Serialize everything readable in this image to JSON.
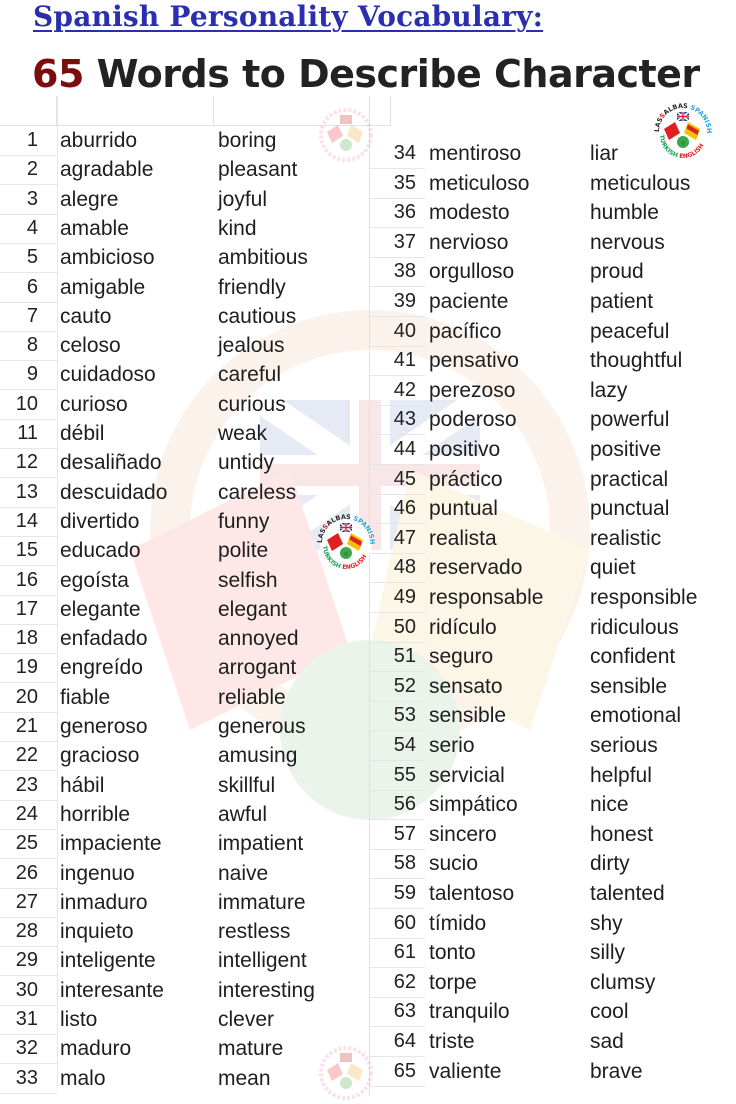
{
  "header": {
    "title": "Spanish Personality Vocabulary:",
    "subtitle_number": "65",
    "subtitle_text": " Words to Describe Character"
  },
  "colors": {
    "title_blue": "#2a2fb0",
    "number_red": "#7b0d0d",
    "text_dark": "#222222"
  },
  "logo": {
    "icon": "lassalbas-flags-logo-icon",
    "ring_text_top": "LASSALBAS SPANISH",
    "ring_text_bottom": "TURKISH ENGLISH"
  },
  "left_column": [
    {
      "n": "1",
      "es": "aburrido",
      "en": "boring"
    },
    {
      "n": "2",
      "es": "agradable",
      "en": "pleasant"
    },
    {
      "n": "3",
      "es": "alegre",
      "en": "joyful"
    },
    {
      "n": "4",
      "es": "amable",
      "en": "kind"
    },
    {
      "n": "5",
      "es": "ambicioso",
      "en": "ambitious"
    },
    {
      "n": "6",
      "es": "amigable",
      "en": "friendly"
    },
    {
      "n": "7",
      "es": "cauto",
      "en": "cautious"
    },
    {
      "n": "8",
      "es": "celoso",
      "en": "jealous"
    },
    {
      "n": "9",
      "es": "cuidadoso",
      "en": "careful"
    },
    {
      "n": "10",
      "es": "curioso",
      "en": "curious"
    },
    {
      "n": "11",
      "es": "débil",
      "en": "weak"
    },
    {
      "n": "12",
      "es": "desaliñado",
      "en": "untidy"
    },
    {
      "n": "13",
      "es": "descuidado",
      "en": "careless"
    },
    {
      "n": "14",
      "es": "divertido",
      "en": "funny"
    },
    {
      "n": "15",
      "es": "educado",
      "en": "polite"
    },
    {
      "n": "16",
      "es": "egoísta",
      "en": "selfish"
    },
    {
      "n": "17",
      "es": "elegante",
      "en": "elegant"
    },
    {
      "n": "18",
      "es": "enfadado",
      "en": "annoyed"
    },
    {
      "n": "19",
      "es": "engreído",
      "en": "arrogant"
    },
    {
      "n": "20",
      "es": "fiable",
      "en": "reliable"
    },
    {
      "n": "21",
      "es": "generoso",
      "en": "generous"
    },
    {
      "n": "22",
      "es": "gracioso",
      "en": "amusing"
    },
    {
      "n": "23",
      "es": "hábil",
      "en": "skillful"
    },
    {
      "n": "24",
      "es": "horrible",
      "en": "awful"
    },
    {
      "n": "25",
      "es": "impaciente",
      "en": "impatient"
    },
    {
      "n": "26",
      "es": "ingenuo",
      "en": "naive"
    },
    {
      "n": "27",
      "es": "inmaduro",
      "en": "immature"
    },
    {
      "n": "28",
      "es": "inquieto",
      "en": "restless"
    },
    {
      "n": "29",
      "es": "inteligente",
      "en": "intelligent"
    },
    {
      "n": "30",
      "es": "interesante",
      "en": "interesting"
    },
    {
      "n": "31",
      "es": "listo",
      "en": "clever"
    },
    {
      "n": "32",
      "es": "maduro",
      "en": "mature"
    },
    {
      "n": "33",
      "es": "malo",
      "en": "mean"
    }
  ],
  "right_column": [
    {
      "n": "34",
      "es": "mentiroso",
      "en": "liar"
    },
    {
      "n": "35",
      "es": "meticuloso",
      "en": "meticulous"
    },
    {
      "n": "36",
      "es": "modesto",
      "en": "humble"
    },
    {
      "n": "37",
      "es": "nervioso",
      "en": "nervous"
    },
    {
      "n": "38",
      "es": "orgulloso",
      "en": "proud"
    },
    {
      "n": "39",
      "es": "paciente",
      "en": "patient"
    },
    {
      "n": "40",
      "es": "pacífico",
      "en": "peaceful"
    },
    {
      "n": "41",
      "es": "pensativo",
      "en": "thoughtful"
    },
    {
      "n": "42",
      "es": "perezoso",
      "en": "lazy"
    },
    {
      "n": "43",
      "es": "poderoso",
      "en": "powerful"
    },
    {
      "n": "44",
      "es": "positivo",
      "en": "positive"
    },
    {
      "n": "45",
      "es": "práctico",
      "en": "practical"
    },
    {
      "n": "46",
      "es": "puntual",
      "en": "punctual"
    },
    {
      "n": "47",
      "es": "realista",
      "en": "realistic"
    },
    {
      "n": "48",
      "es": "reservado",
      "en": "quiet"
    },
    {
      "n": "49",
      "es": "responsable",
      "en": "responsible"
    },
    {
      "n": "50",
      "es": "ridículo",
      "en": "ridiculous"
    },
    {
      "n": "51",
      "es": "seguro",
      "en": "confident"
    },
    {
      "n": "52",
      "es": "sensato",
      "en": "sensible"
    },
    {
      "n": "53",
      "es": "sensible",
      "en": "emotional"
    },
    {
      "n": "54",
      "es": "serio",
      "en": "serious"
    },
    {
      "n": "55",
      "es": "servicial",
      "en": "helpful"
    },
    {
      "n": "56",
      "es": "simpático",
      "en": "nice"
    },
    {
      "n": "57",
      "es": "sincero",
      "en": "honest"
    },
    {
      "n": "58",
      "es": "sucio",
      "en": "dirty"
    },
    {
      "n": "59",
      "es": "talentoso",
      "en": "talented"
    },
    {
      "n": "60",
      "es": "tímido",
      "en": "shy"
    },
    {
      "n": "61",
      "es": "tonto",
      "en": "silly"
    },
    {
      "n": "62",
      "es": "torpe",
      "en": "clumsy"
    },
    {
      "n": "63",
      "es": "tranquilo",
      "en": "cool"
    },
    {
      "n": "64",
      "es": "triste",
      "en": "sad"
    },
    {
      "n": "65",
      "es": "valiente",
      "en": "brave"
    }
  ]
}
